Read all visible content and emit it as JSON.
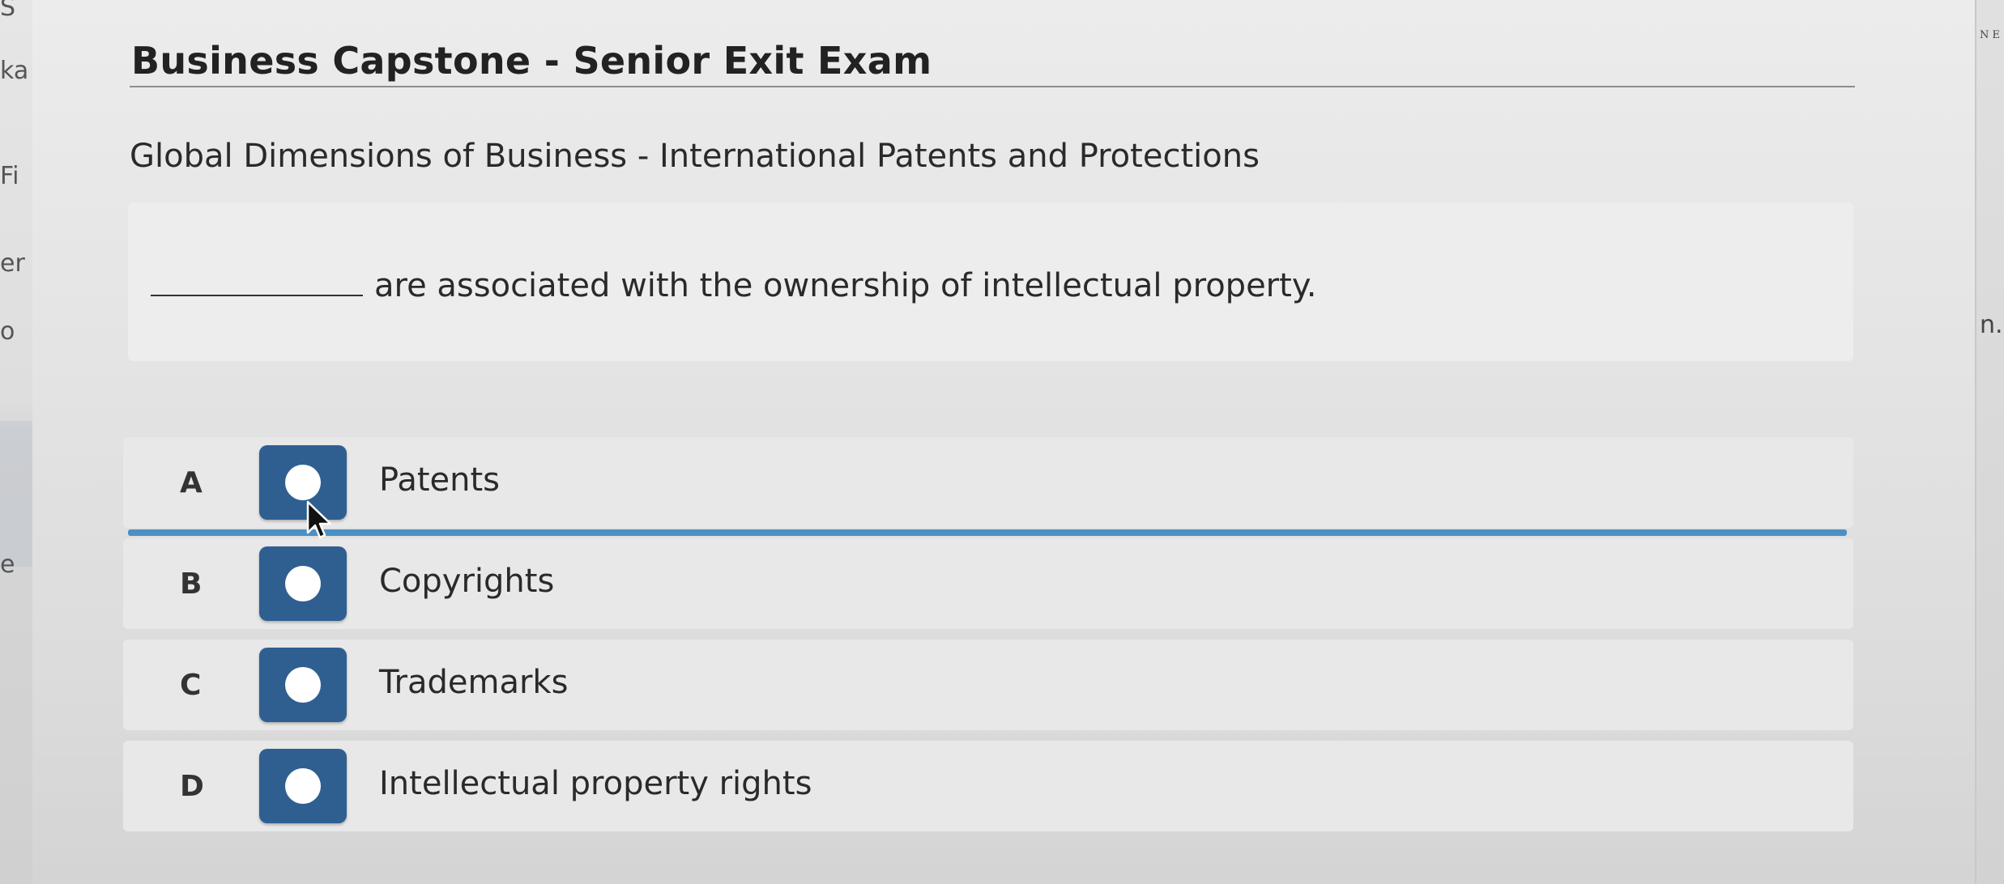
{
  "exam": {
    "title": "Business Capstone - Senior Exit Exam",
    "topic": "Global Dimensions of Business - International Patents and Protections"
  },
  "question": {
    "text": "are associated with the ownership of intellectual property."
  },
  "answers": [
    {
      "letter": "A",
      "label": "Patents"
    },
    {
      "letter": "B",
      "label": "Copyrights"
    },
    {
      "letter": "C",
      "label": "Trademarks"
    },
    {
      "letter": "D",
      "label": "Intellectual property rights"
    }
  ],
  "background_fragments": {
    "left": [
      "S",
      "ka",
      "Fi",
      "er",
      "o",
      "e"
    ],
    "right": [
      "N E",
      "n."
    ]
  },
  "colors": {
    "radio_box": "#2f5f91",
    "hover_line": "#4b90c4",
    "background": "#e4e4e4"
  },
  "icons": {
    "radio": "radio-circle-icon",
    "cursor": "mouse-pointer-icon"
  }
}
